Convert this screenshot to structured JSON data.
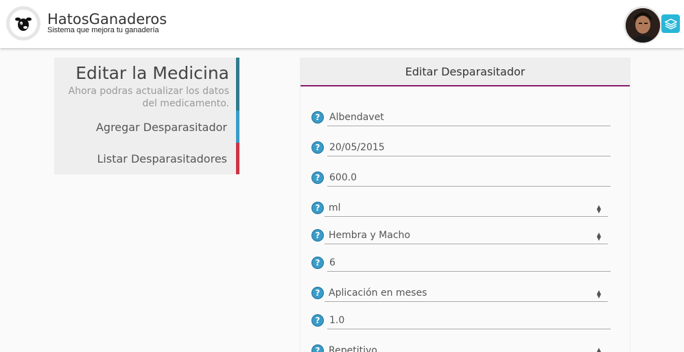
{
  "header": {
    "brand_title": "HatosGanaderos",
    "brand_subtitle": "Sistema que mejora tu ganadería",
    "logo_icon": "cow-icon",
    "avatar_icon": "user-avatar",
    "layers_icon": "layers-icon"
  },
  "sidebar": {
    "title": "Editar la Medicina",
    "description": "Ahora podras actualizar los datos del medicamento.",
    "links": [
      {
        "label": "Agregar Desparasitador"
      },
      {
        "label": "Listar Desparasitadores"
      }
    ]
  },
  "form": {
    "header": "Editar Desparasitador",
    "fields": [
      {
        "value": "Albendavet",
        "type": "text"
      },
      {
        "value": "20/05/2015",
        "type": "text"
      },
      {
        "value": "600.0",
        "type": "text"
      },
      {
        "value": "ml",
        "type": "select"
      },
      {
        "value": "Hembra y Macho",
        "type": "select"
      },
      {
        "value": "6",
        "type": "text"
      },
      {
        "value": "Aplicación en meses",
        "type": "select"
      },
      {
        "value": "1.0",
        "type": "text"
      },
      {
        "value": "Repetitivo",
        "type": "select"
      }
    ],
    "help_glyph": "?"
  },
  "colors": {
    "accent_header_underline": "#8a1a6a",
    "sidebar_teal": "#2f7a8d",
    "sidebar_blue": "#3a9cc8",
    "sidebar_red": "#cc3344",
    "layers_button": "#29b6d8"
  }
}
